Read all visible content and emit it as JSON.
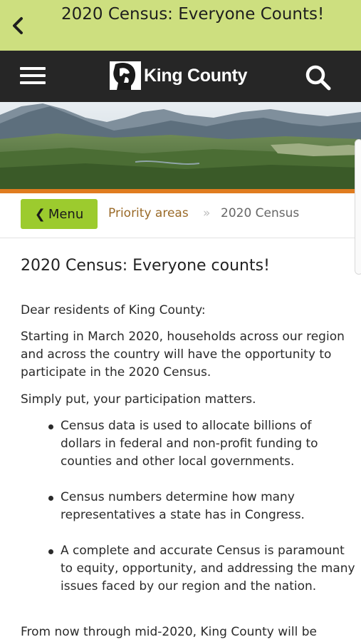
{
  "app_bar": {
    "title": "2020 Census: Everyone Counts!"
  },
  "site_header": {
    "logo_text": "King County"
  },
  "breadcrumb": {
    "menu_label": "Menu",
    "items": [
      "Priority areas",
      "2020 Census"
    ],
    "separator": "»"
  },
  "content": {
    "title": "2020 Census: Everyone counts!",
    "greeting": "Dear residents of King County:",
    "intro": "Starting in March 2020, households across our region and across the country will have the opportunity to participate in the 2020 Census.",
    "emphasis": "Simply put, your participation matters.",
    "bullets": [
      "Census data is used to allocate billions of dollars in federal and non-profit funding to counties and other local governments.",
      "Census numbers determine how many representatives a state has in Congress.",
      "A complete and accurate Census is paramount to equity, opportunity, and addressing the many issues faced by our region and the nation."
    ],
    "closing": "From now through mid-2020, King County will be"
  },
  "icons": {
    "back": "chevron-left-icon",
    "menu": "hamburger-icon",
    "search": "search-icon",
    "logo": "king-county-logo-icon"
  },
  "colors": {
    "app_bar": "#cddf7f",
    "header": "#262626",
    "accent_orange": "#e07c1f",
    "menu_button": "#9ccb2e",
    "link": "#9a6a28"
  }
}
